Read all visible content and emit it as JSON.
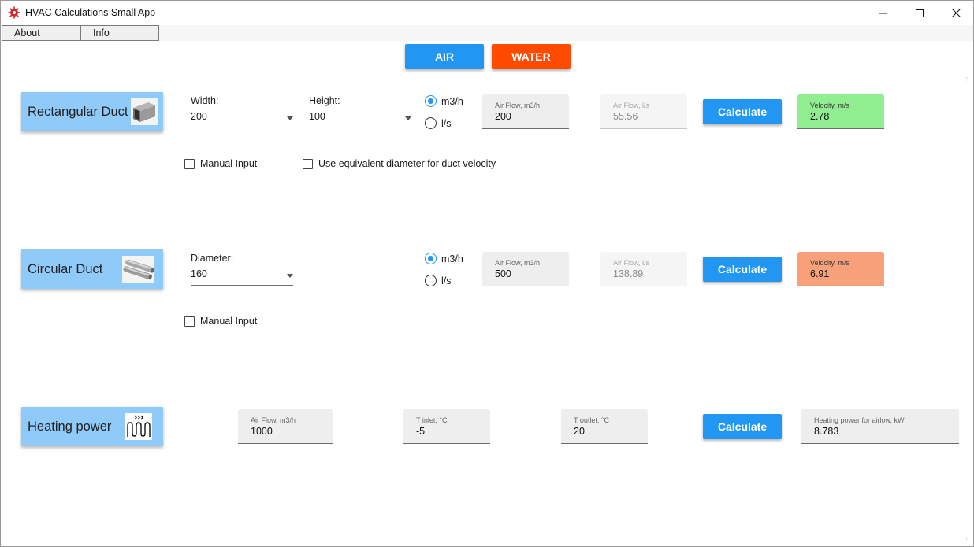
{
  "window": {
    "title": "HVAC Calculations Small App"
  },
  "menu": {
    "about": "About",
    "info": "Info"
  },
  "mode": {
    "air": "AIR",
    "water": "WATER"
  },
  "rectangular": {
    "title": "Rectangular Duct",
    "width_label": "Width:",
    "width_value": "200",
    "height_label": "Height:",
    "height_value": "100",
    "unit_m3h": "m3/h",
    "unit_ls": "l/s",
    "airflow_label": "Air Flow, m3/h",
    "airflow_value": "200",
    "airflow_ls_label": "Air Flow, l/s",
    "airflow_ls_value": "55.56",
    "calculate": "Calculate",
    "velocity_label": "Velocity, m/s",
    "velocity_value": "2.78",
    "manual_input": "Manual Input",
    "equiv_diameter": "Use equivalent diameter for duct velocity"
  },
  "circular": {
    "title": "Circular Duct",
    "diameter_label": "Diameter:",
    "diameter_value": "160",
    "unit_m3h": "m3/h",
    "unit_ls": "l/s",
    "airflow_label": "Air Flow, m3/h",
    "airflow_value": "500",
    "airflow_ls_label": "Air Flow, l/s",
    "airflow_ls_value": "138.89",
    "calculate": "Calculate",
    "velocity_label": "Velocity, m/s",
    "velocity_value": "6.91",
    "manual_input": "Manual Input"
  },
  "heating": {
    "title": "Heating power",
    "airflow_label": "Air Flow, m3/h",
    "airflow_value": "1000",
    "t_inlet_label": "T inlet, °C",
    "t_inlet_value": "-5",
    "t_outlet_label": "T outlet, °C",
    "t_outlet_value": "20",
    "calculate": "Calculate",
    "power_label": "Heating power for airlow, kW",
    "power_value": "8.783"
  },
  "colors": {
    "accent_blue": "#2196f3",
    "water_orange": "#ff4a00",
    "card_blue": "#90caf9",
    "velocity_ok": "#90ee90",
    "velocity_high": "#f8a07a"
  }
}
